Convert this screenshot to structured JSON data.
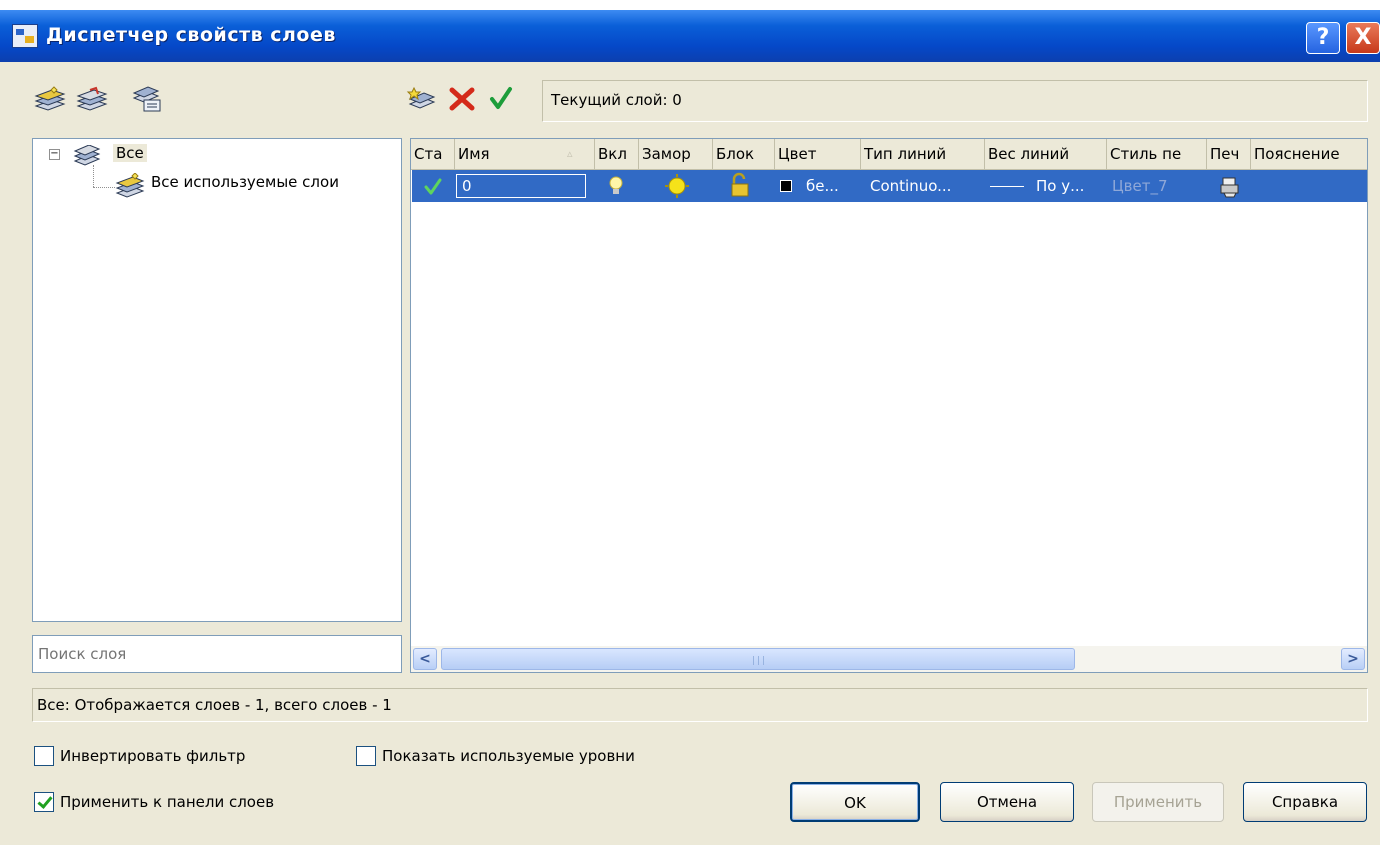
{
  "window": {
    "title": "Диспетчер свойств слоев",
    "help_button": "?",
    "close_button": "X"
  },
  "toolbar": {
    "current_layer": "Текущий слой: 0"
  },
  "tree": {
    "root_label": "Все",
    "child_label": "Все используемые слои"
  },
  "search": {
    "placeholder": "Поиск слоя"
  },
  "table": {
    "columns": [
      "Ста",
      "Имя",
      "Вкл",
      "Замор",
      "Блок",
      "Цвет",
      "Тип линий",
      "Вес линий",
      "Стиль пе",
      "Печ",
      "Пояснение"
    ],
    "rows": [
      {
        "status_icon": "check-icon",
        "name": "0",
        "on_icon": "lightbulb-icon",
        "freeze_icon": "sun-icon",
        "lock_icon": "unlocked-icon",
        "color_swatch": "#000000",
        "color": "бе...",
        "linetype": "Continuo...",
        "lineweight": "По у...",
        "plot_style": "Цвет_7",
        "plot_icon": "printer-icon"
      }
    ]
  },
  "status_text": "Все: Отображается слоев - 1, всего слоев - 1",
  "options": {
    "invert_filter": {
      "label": "Инвертировать фильтр",
      "checked": false
    },
    "show_used_levels": {
      "label": "Показать используемые уровни",
      "checked": false
    },
    "apply_to_panel": {
      "label": "Применить к панели слоев",
      "checked": true
    }
  },
  "buttons": {
    "ok": "OK",
    "cancel": "Отмена",
    "apply": "Применить",
    "help": "Справка"
  },
  "colors": {
    "title_bar": "#0a5fd8",
    "selection": "#316ac5",
    "dialog_bg": "#ece9d8",
    "delete_red": "#d42a1a",
    "check_green": "#1d9d3a"
  }
}
